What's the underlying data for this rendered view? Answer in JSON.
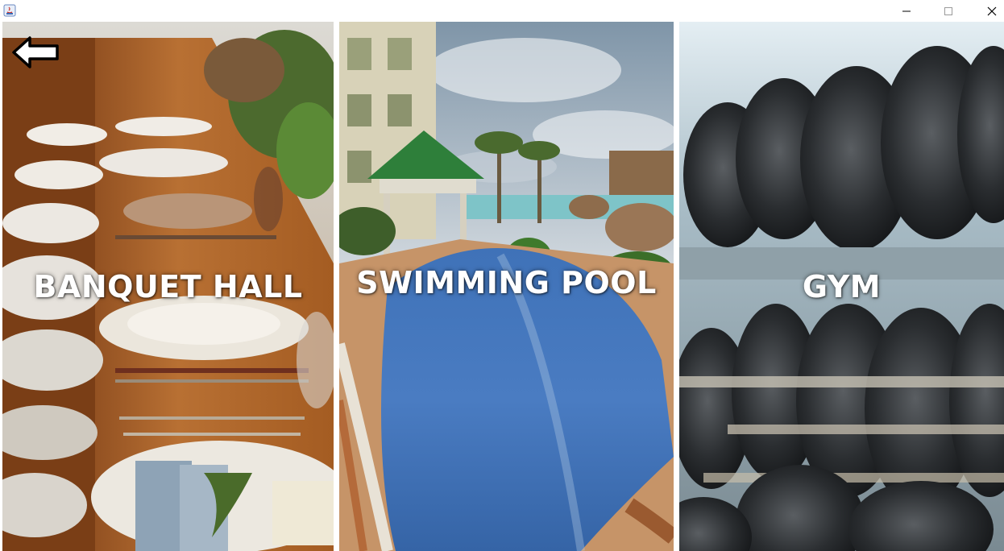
{
  "window": {
    "app_icon": "java-app-icon",
    "controls": {
      "minimize": "minimize-icon",
      "maximize": "maximize-icon",
      "close": "close-icon"
    }
  },
  "navigation": {
    "back_icon": "back-arrow-icon"
  },
  "panels": [
    {
      "id": "banquet",
      "label": "BANQUET HALL",
      "image": "banquet-table-photo"
    },
    {
      "id": "pool",
      "label": "SWIMMING POOL",
      "image": "resort-pool-photo"
    },
    {
      "id": "gym",
      "label": "GYM",
      "image": "dumbbell-rack-photo"
    }
  ],
  "colors": {
    "label_text": "#ffffff",
    "background": "#ffffff"
  }
}
